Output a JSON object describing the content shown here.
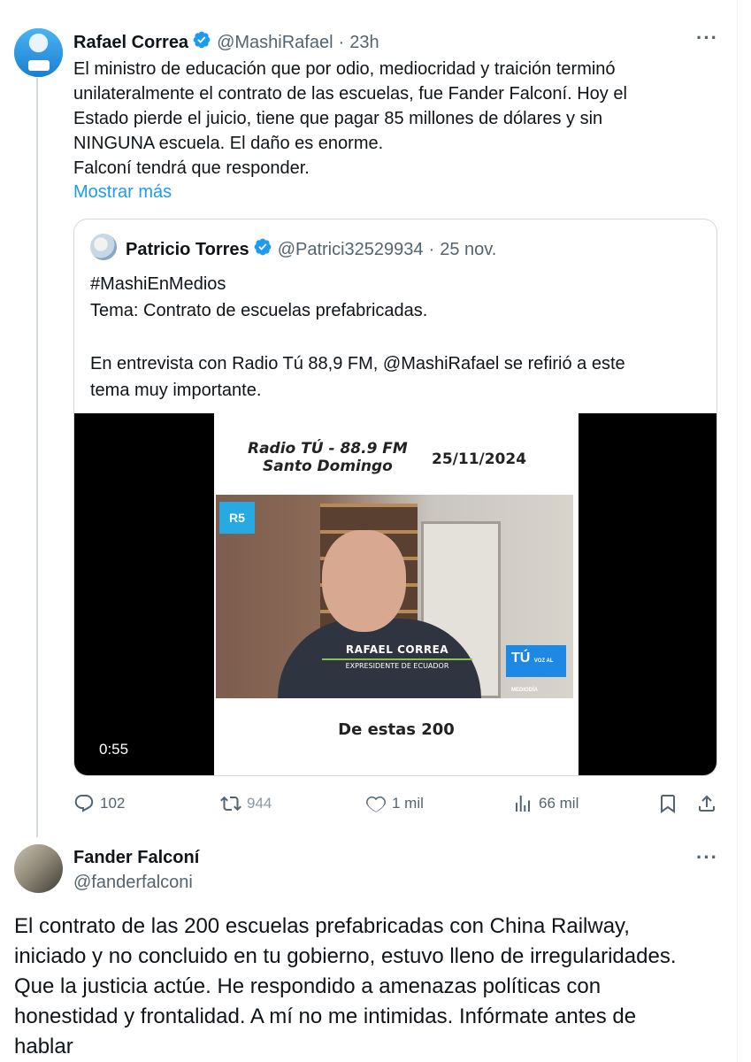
{
  "tweet": {
    "author_name": "Rafael Correa",
    "author_handle": "@MashiRafael",
    "separator": "·",
    "time": "23h",
    "text": "El ministro de educación que por odio, mediocridad y traición terminó\nunilateralmente el contrato de las escuelas, fue Fander Falconí. Hoy el\nEstado pierde el juicio, tiene que pagar 85 millones de dólares y sin\nNINGUNA escuela. El daño es enorme.\nFalconí tendrá que responder.",
    "show_more": "Mostrar más",
    "more_menu": "···"
  },
  "quote": {
    "author_name": "Patricio Torres",
    "author_handle": "@Patrici32529934",
    "separator": "·",
    "time": "25 nov.",
    "text": "#MashiEnMedios\nTema: Contrato de escuelas prefabricadas.\n\nEn entrevista con Radio Tú 88,9 FM, @MashiRafael se refirió a este\ntema muy importante.",
    "video": {
      "radio_line1": "Radio TÚ - 88.9 FM",
      "radio_line2": "Santo Domingo",
      "date": "25/11/2024",
      "logo_left": "R5",
      "lower_third_name": "RAFAEL CORREA",
      "lower_third_title": "EXPRESIDENTE DE ECUADOR",
      "logo_right": "TÚ",
      "logo_right_sub": "VOZ AL MEDIODÍA",
      "caption": "De estas 200",
      "duration": "0:55"
    }
  },
  "actions": {
    "replies": "102",
    "reposts": "944",
    "likes": "1 mil",
    "views": "66 mil"
  },
  "reply": {
    "author_name": "Fander Falconí",
    "author_handle": "@fanderfalconi",
    "more_menu": "···",
    "text": "El contrato de las 200 escuelas prefabricadas con China Railway,\niniciado y no concluido en tu gobierno, estuvo lleno de irregularidades.\nQue la justicia actúe. He respondido a amenazas políticas con\nhonestidad y frontalidad. A mí no me intimidas. Infórmate antes de\nhablar"
  },
  "colors": {
    "accent": "#1d9bf0",
    "secondary_text": "#536471",
    "border": "#cfd9de"
  }
}
